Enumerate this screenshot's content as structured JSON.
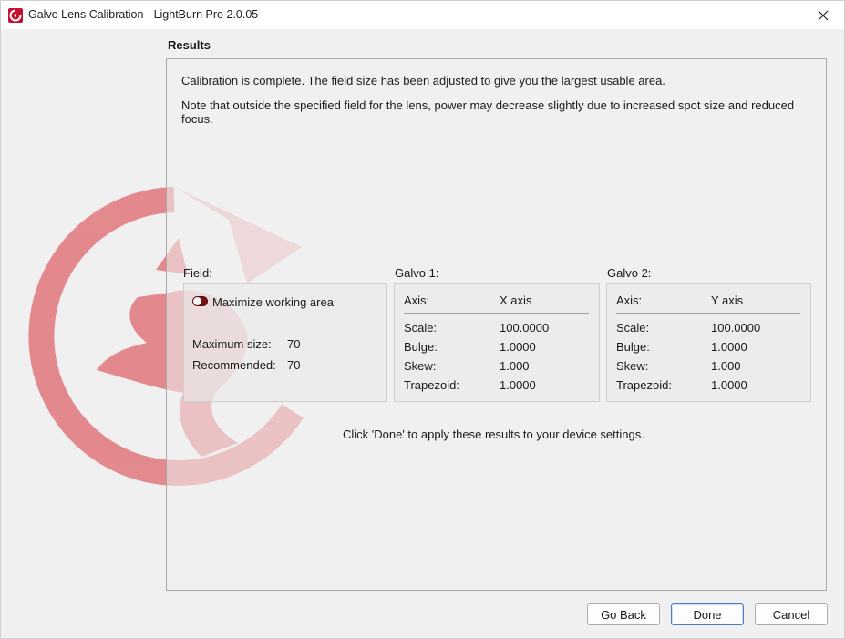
{
  "window": {
    "title": "Galvo Lens Calibration - LightBurn Pro 2.0.05"
  },
  "page": {
    "heading": "Results",
    "message_complete": "Calibration is complete. The field size has been adjusted to give you the largest usable area.",
    "message_note": "Note that outside the specified field for the lens, power may decrease slightly due to increased spot size and reduced focus.",
    "instruction": "Click 'Done' to apply these results to your device settings."
  },
  "field": {
    "label": "Field:",
    "toggle_label": "Maximize working area",
    "toggle_on": true,
    "max_size_label": "Maximum size:",
    "max_size_value": "70",
    "recommended_label": "Recommended:",
    "recommended_value": "70"
  },
  "galvo1": {
    "label": "Galvo 1:",
    "axis_label": "Axis:",
    "axis_value": "X axis",
    "scale_label": "Scale:",
    "scale_value": "100.0000",
    "bulge_label": "Bulge:",
    "bulge_value": "1.0000",
    "skew_label": "Skew:",
    "skew_value": "1.000",
    "trapezoid_label": "Trapezoid:",
    "trapezoid_value": "1.0000"
  },
  "galvo2": {
    "label": "Galvo 2:",
    "axis_label": "Axis:",
    "axis_value": "Y axis",
    "scale_label": "Scale:",
    "scale_value": "100.0000",
    "bulge_label": "Bulge:",
    "bulge_value": "1.0000",
    "skew_label": "Skew:",
    "skew_value": "1.000",
    "trapezoid_label": "Trapezoid:",
    "trapezoid_value": "1.0000"
  },
  "buttons": {
    "back": "Go Back",
    "done": "Done",
    "cancel": "Cancel"
  },
  "icons": {
    "app": "lightburn-logo-icon",
    "close": "close-icon",
    "watermark": "lightburn-dragon-watermark"
  },
  "colors": {
    "brand_red": "#c8102e",
    "toggle_on": "#7a1014"
  }
}
